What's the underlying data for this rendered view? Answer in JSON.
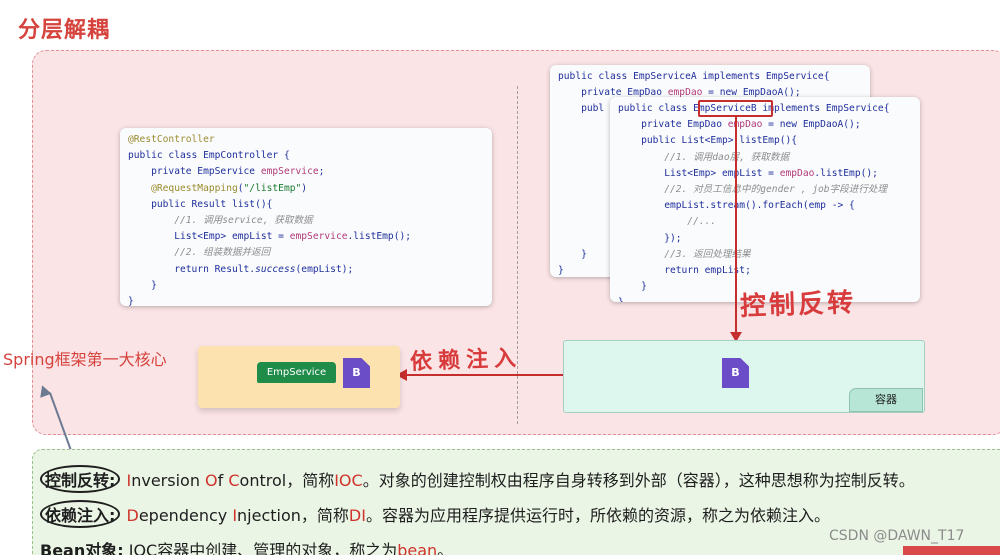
{
  "title": "分层解耦",
  "controller_code": [
    [
      [
        "an",
        "@RestController"
      ]
    ],
    [
      [
        "k",
        "public class EmpController {"
      ]
    ],
    [
      [
        "k",
        "    private EmpService "
      ],
      [
        "f",
        "empService"
      ],
      [
        "k",
        ";"
      ]
    ],
    [
      [
        "an",
        "    @RequestMapping"
      ],
      [
        "k",
        "("
      ],
      [
        "s",
        "\"/listEmp\""
      ],
      [
        "k",
        ")"
      ]
    ],
    [
      [
        "k",
        "    public Result list(){"
      ]
    ],
    [
      [
        "cm",
        "        //1. 调用service, 获取数据"
      ]
    ],
    [
      [
        "k",
        "        List<Emp> empList = "
      ],
      [
        "f",
        "empService"
      ],
      [
        "k",
        ".listEmp();"
      ]
    ],
    [
      [
        "cm",
        "        //2. 组装数据并返回"
      ]
    ],
    [
      [
        "k",
        "        return Result."
      ],
      [
        "it",
        "success"
      ],
      [
        "k",
        "(empList);"
      ]
    ],
    [
      [
        "k",
        "    }"
      ]
    ],
    [
      [
        "k",
        "}"
      ]
    ]
  ],
  "service_a_code": [
    [
      [
        "k",
        "public class EmpServiceA implements EmpService{"
      ]
    ],
    [
      [
        "k",
        "    private EmpDao "
      ],
      [
        "f",
        "empDao"
      ],
      [
        "k",
        " = new EmpDaoA();"
      ]
    ],
    [
      [
        "k",
        "    publ"
      ]
    ],
    [
      [
        "k",
        ""
      ]
    ],
    [
      [
        "k",
        ""
      ]
    ],
    [
      [
        "k",
        ""
      ]
    ],
    [
      [
        "k",
        ""
      ]
    ],
    [
      [
        "k",
        ""
      ]
    ],
    [
      [
        "k",
        ""
      ]
    ],
    [
      [
        "k",
        ""
      ]
    ],
    [
      [
        "k",
        ""
      ]
    ],
    [
      [
        "k",
        "    }"
      ]
    ],
    [
      [
        "k",
        "}"
      ]
    ]
  ],
  "service_b_code": [
    [
      [
        "k",
        "public class EmpServiceB implements EmpService{"
      ]
    ],
    [
      [
        "k",
        "    private EmpDao "
      ],
      [
        "f",
        "empDao"
      ],
      [
        "k",
        " = new EmpDaoA();"
      ]
    ],
    [
      [
        "k",
        "    public List<Emp> listEmp(){"
      ]
    ],
    [
      [
        "cm",
        "        //1. 调用dao层, 获取数据"
      ]
    ],
    [
      [
        "k",
        "        List<Emp> empList = "
      ],
      [
        "f",
        "empDao"
      ],
      [
        "k",
        ".listEmp();"
      ]
    ],
    [
      [
        "cm",
        "        //2. 对员工信息中的gender , job字段进行处理"
      ]
    ],
    [
      [
        "k",
        "        empList.stream().forEach(emp -> {"
      ]
    ],
    [
      [
        "cm",
        "            //..."
      ]
    ],
    [
      [
        "k",
        "        });"
      ]
    ],
    [
      [
        "cm",
        "        //3. 返回处理结果"
      ]
    ],
    [
      [
        "k",
        "        return empList;"
      ]
    ],
    [
      [
        "k",
        "    }"
      ]
    ],
    [
      [
        "k",
        "}"
      ]
    ]
  ],
  "labels": {
    "ioc": "控制反转",
    "di": "依赖注入",
    "emp_service": "EmpService",
    "bean_b": "B",
    "container": "容器",
    "spring_core": "Spring框架第一大核心"
  },
  "definitions": {
    "ioc_term": "控制反转:",
    "ioc_rest": [
      [
        "",
        " "
      ],
      [
        "red",
        "I"
      ],
      [
        "",
        "nversion "
      ],
      [
        "red",
        "O"
      ],
      [
        "",
        "f "
      ],
      [
        "red",
        "C"
      ],
      [
        "",
        "ontrol，简称"
      ],
      [
        "red",
        "IOC"
      ],
      [
        "",
        "。对象的创建控制权由程序自身转移到外部（容器），这种思想称为控制反转。"
      ]
    ],
    "di_term": "依赖注入:",
    "di_rest": [
      [
        "",
        " "
      ],
      [
        "red",
        "D"
      ],
      [
        "",
        "ependency "
      ],
      [
        "red",
        "I"
      ],
      [
        "",
        "njection，简称"
      ],
      [
        "red",
        "DI"
      ],
      [
        "",
        "。容器为应用程序提供运行时，所依赖的资源，称之为依赖注入。"
      ]
    ],
    "bean_term": "Bean对象:",
    "bean_rest": [
      [
        "",
        " IOC容器中创建、管理的对象，称之为"
      ],
      [
        "red",
        "bean"
      ],
      [
        "",
        "。"
      ]
    ]
  },
  "watermark": "CSDN @DAWN_T17"
}
